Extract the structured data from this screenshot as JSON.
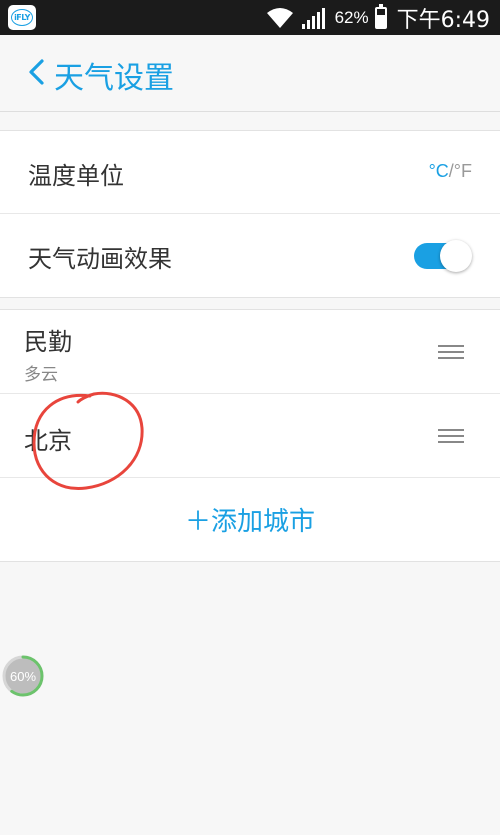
{
  "status_bar": {
    "app_icon_text": "iFLY",
    "battery_percent": "62%",
    "battery_level": 0.62,
    "time": "下午6:49",
    "icons": [
      "wifi-icon",
      "signal-icon",
      "battery-icon"
    ]
  },
  "header": {
    "back_icon": "chevron-left-icon",
    "title": "天气设置"
  },
  "settings": {
    "temperature_unit": {
      "label": "温度单位",
      "celsius": "°C",
      "separator": "/",
      "fahrenheit": "°F",
      "selected": "°C"
    },
    "weather_animation": {
      "label": "天气动画效果",
      "enabled": true
    }
  },
  "cities": [
    {
      "name": "民勤",
      "weather": "多云"
    },
    {
      "name": "北京",
      "weather": ""
    }
  ],
  "add_city": {
    "label": "＋添加城市"
  },
  "progress_badge": {
    "text": "60%",
    "value": 0.6
  },
  "colors": {
    "accent": "#1aa0e3",
    "annotation": "#e8453c",
    "progress": "#6cc36c",
    "status_bar": "#1b1b1b"
  }
}
